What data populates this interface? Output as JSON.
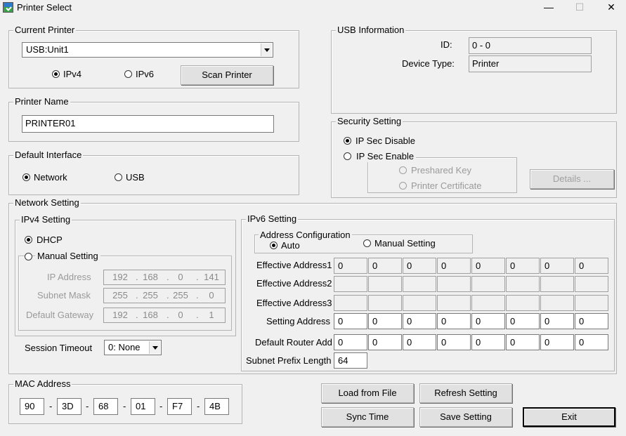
{
  "window": {
    "title": "Printer Select",
    "minimize": "—",
    "maximize": "☐",
    "close": "✕",
    "icon": "printer-app-icon"
  },
  "current_printer": {
    "legend": "Current Printer",
    "selected": "USB:Unit1",
    "ipv4_label": "IPv4",
    "ipv6_label": "IPv6",
    "ipv4_checked": true,
    "scan_button": "Scan Printer"
  },
  "printer_name": {
    "legend": "Printer Name",
    "value": "PRINTER01"
  },
  "default_interface": {
    "legend": "Default Interface",
    "network_label": "Network",
    "usb_label": "USB",
    "network_checked": true
  },
  "usb_info": {
    "legend": "USB Information",
    "id_label": "ID:",
    "id_value": "0 - 0",
    "type_label": "Device Type:",
    "type_value": "Printer"
  },
  "security": {
    "legend": "Security Setting",
    "disable_label": "IP Sec Disable",
    "enable_label": "IP Sec Enable",
    "preshared_label": "Preshared Key",
    "certificate_label": "Printer Certificate",
    "details_button": "Details ...",
    "disable_checked": true
  },
  "network": {
    "legend": "Network Setting",
    "ipv4": {
      "legend": "IPv4 Setting",
      "dhcp_label": "DHCP",
      "manual_label": "Manual Setting",
      "dhcp_checked": true,
      "ip_label": "IP Address",
      "ip": [
        "192",
        "168",
        "0",
        "141"
      ],
      "mask_label": "Subnet Mask",
      "mask": [
        "255",
        "255",
        "255",
        "0"
      ],
      "gateway_label": "Default Gateway",
      "gateway": [
        "192",
        "168",
        "0",
        "1"
      ]
    },
    "session_label": "Session Timeout",
    "session_value": "0: None",
    "ipv6": {
      "legend": "IPv6 Setting",
      "addr_config_legend": "Address Configuration",
      "auto_label": "Auto",
      "manual_label": "Manual Setting",
      "auto_checked": true,
      "effective1_label": "Effective Address1",
      "effective1": [
        "0",
        "0",
        "0",
        "0",
        "0",
        "0",
        "0",
        "0"
      ],
      "effective2_label": "Effective Address2",
      "effective2": [
        "",
        "",
        "",
        "",
        "",
        "",
        "",
        ""
      ],
      "effective3_label": "Effective Address3",
      "effective3": [
        "",
        "",
        "",
        "",
        "",
        "",
        "",
        ""
      ],
      "setting_label": "Setting Address",
      "setting": [
        "0",
        "0",
        "0",
        "0",
        "0",
        "0",
        "0",
        "0"
      ],
      "router_label": "Default Router Add",
      "router": [
        "0",
        "0",
        "0",
        "0",
        "0",
        "0",
        "0",
        "0"
      ],
      "prefix_label": "Subnet Prefix Length",
      "prefix": "64"
    }
  },
  "mac": {
    "legend": "MAC Address",
    "octets": [
      "90",
      "3D",
      "68",
      "01",
      "F7",
      "4B"
    ],
    "separator": "-"
  },
  "buttons": {
    "load": "Load from File",
    "refresh": "Refresh Setting",
    "sync": "Sync Time",
    "save": "Save Setting",
    "exit": "Exit"
  }
}
